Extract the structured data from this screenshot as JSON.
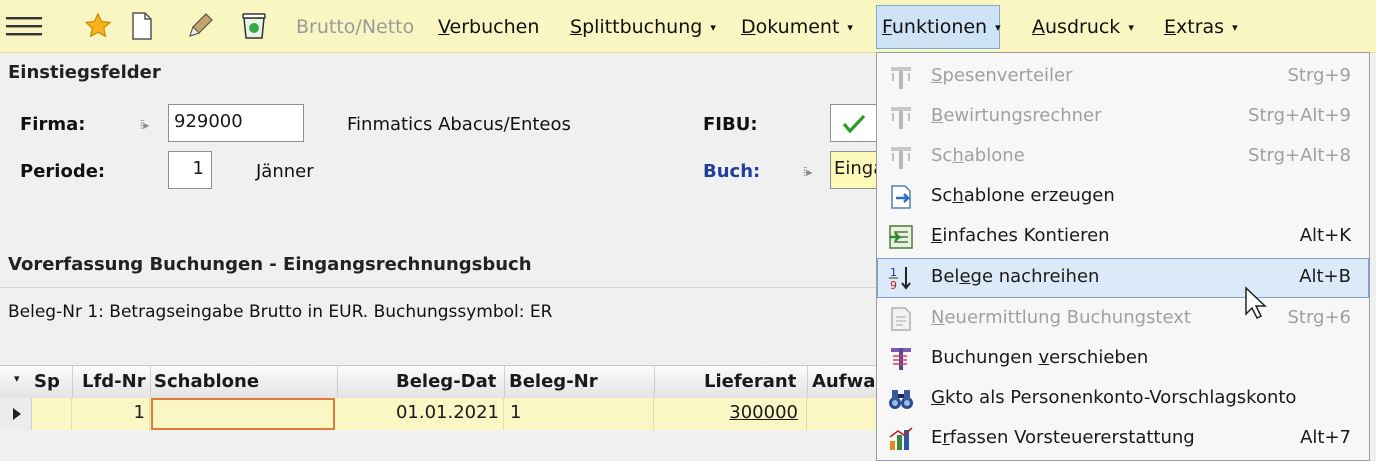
{
  "toolbar": {
    "items": {
      "brutto_netto": {
        "label": "Brutto/Netto",
        "disabled": true
      },
      "verbuchen": {
        "label": "Verbuchen",
        "accel": "V",
        "rest": "erbuchen"
      },
      "splittbuchung": {
        "label": "Splittbuchung",
        "accel": "S",
        "rest": "plittbuchung"
      },
      "dokument": {
        "label": "Dokument",
        "accel": "D",
        "rest": "okument"
      },
      "funktionen": {
        "label": "Funktionen",
        "accel": "F",
        "rest": "unktionen",
        "active": true
      },
      "ausdruck": {
        "label": "Ausdruck",
        "accel": "A",
        "rest": "usdruck"
      },
      "extras": {
        "label": "Extras",
        "accel": "E",
        "rest": "xtras"
      }
    },
    "icons": [
      "hamburger-menu-icon",
      "favorite-star-icon",
      "new-document-icon",
      "edit-pencil-icon",
      "recycle-bin-icon"
    ],
    "caret": "▾"
  },
  "form": {
    "section_title": "Einstiegsfelder",
    "firma_label": "Firma:",
    "firma_value": "929000",
    "firma_name": "Finmatics Abacus/Enteos",
    "periode_label": "Periode:",
    "periode_value": "1",
    "periode_name": "Jänner",
    "fibu_label": "FIBU:",
    "fibu_checked": true,
    "buch_label": "Buch:",
    "buch_value": "Einga",
    "field_marker": "⦙⦙▸"
  },
  "grid": {
    "title": "Vorerfassung Buchungen - Eingangsrechnungsbuch",
    "info": "Beleg-Nr 1: Betragseingabe Brutto in EUR. Buchungssymbol: ER",
    "columns": [
      "Sp",
      "Lfd-Nr",
      "Schablone",
      "Beleg-Dat",
      "Beleg-Nr",
      "Lieferant",
      "Aufwa"
    ],
    "rows": [
      {
        "sp": "",
        "lfd_nr": "1",
        "schablone": "",
        "beleg_dat": "01.01.2021",
        "beleg_nr": "1",
        "lieferant": "300000",
        "aufwand": ""
      }
    ]
  },
  "menu": {
    "items": [
      {
        "pre": "",
        "accel": "S",
        "post": "pesenverteiler",
        "shortcut": "Strg+9",
        "disabled": true,
        "icon": "distribute-icon"
      },
      {
        "pre": "",
        "accel": "B",
        "post": "ewirtungsrechner",
        "shortcut": "Strg+Alt+9",
        "disabled": true,
        "icon": "calculator-distribute-icon"
      },
      {
        "pre": "Sc",
        "accel": "h",
        "post": "ablone",
        "shortcut": "Strg+Alt+8",
        "disabled": true,
        "icon": "template-icon"
      },
      {
        "pre": "Sc",
        "accel": "h",
        "post": "ablone erzeugen",
        "shortcut": "",
        "disabled": false,
        "icon": "create-template-icon"
      },
      {
        "pre": "",
        "accel": "E",
        "post": "infaches Kontieren",
        "shortcut": "Alt+K",
        "disabled": false,
        "icon": "simple-posting-icon"
      },
      {
        "pre": "Bel",
        "accel": "e",
        "post": "ge nachreihen",
        "shortcut": "Alt+B",
        "disabled": false,
        "icon": "renumber-sort-icon",
        "hover": true
      },
      {
        "pre": "",
        "accel": "N",
        "post": "euermittlung Buchungstext",
        "shortcut": "Strg+6",
        "disabled": true,
        "icon": "refresh-text-icon"
      },
      {
        "pre": "Buchungen ",
        "accel": "v",
        "post": "erschieben",
        "shortcut": "",
        "disabled": false,
        "icon": "move-postings-icon"
      },
      {
        "pre": "",
        "accel": "G",
        "post": "kto als Personenkonto-Vorschlagskonto",
        "shortcut": "",
        "disabled": false,
        "icon": "binoculars-icon"
      },
      {
        "pre": "E",
        "accel": "r",
        "post": "fassen Vorsteuererstattung",
        "shortcut": "Alt+7",
        "disabled": false,
        "icon": "tax-refund-chart-icon"
      }
    ]
  },
  "colors": {
    "toolbar_bg": "#faf6c2",
    "active_menu_bg": "#cfe3f7",
    "grid_row_bg": "#fbf7c4",
    "buch_label": "#1f3f9a",
    "check_green": "#2a9a2a",
    "active_cell_border": "#e07a3c"
  }
}
